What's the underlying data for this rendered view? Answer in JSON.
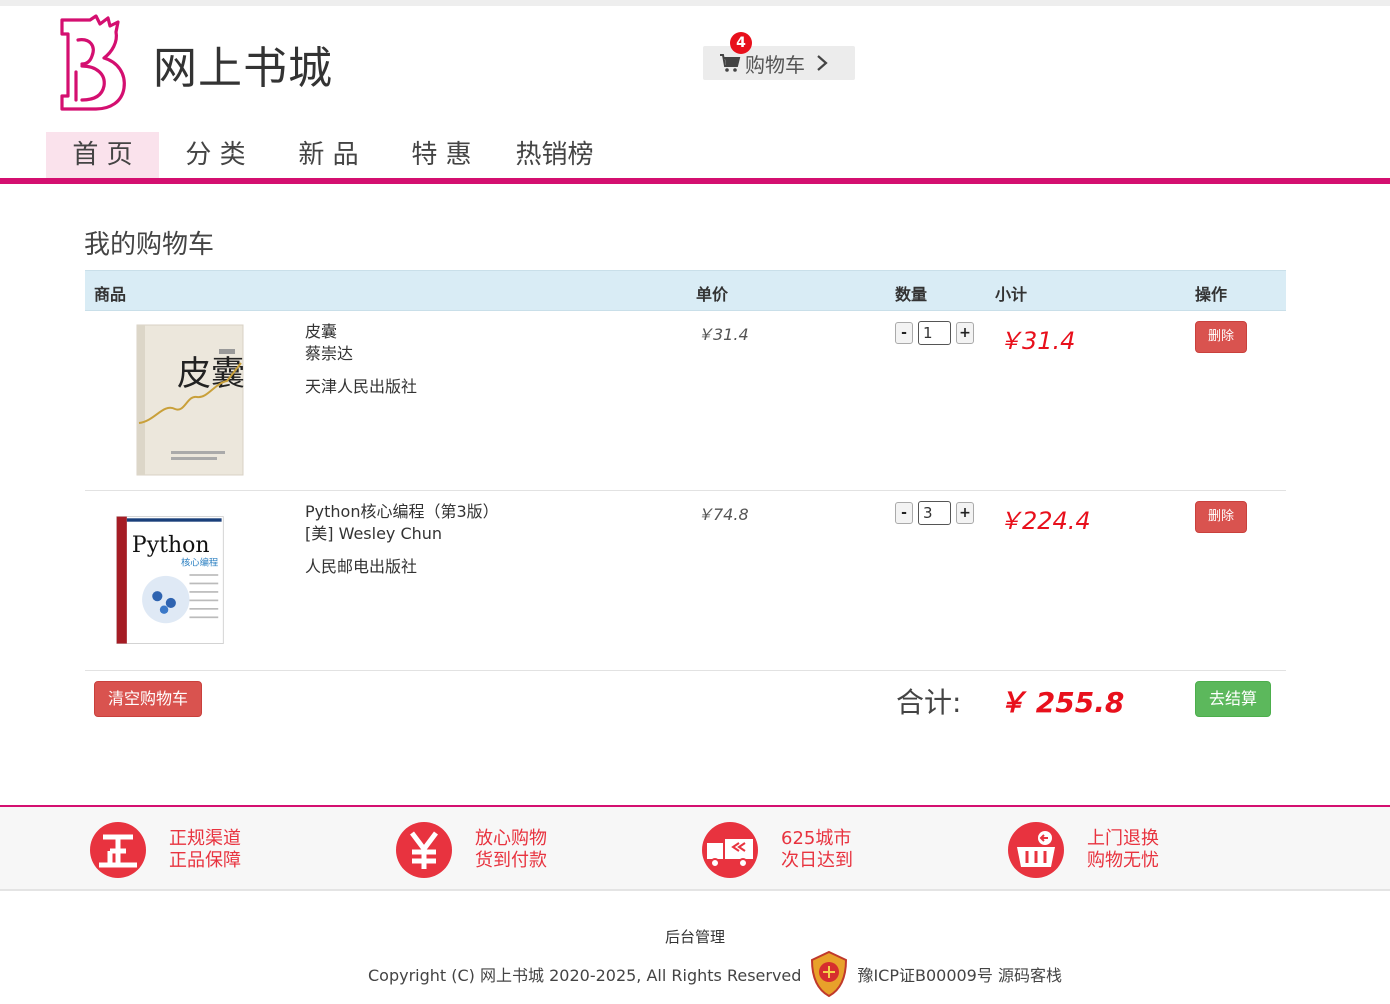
{
  "header": {
    "site_title": "网上书城",
    "cart_label": "购物车",
    "cart_count": "4"
  },
  "nav": {
    "items": [
      {
        "label": "首 页",
        "active": true
      },
      {
        "label": "分 类"
      },
      {
        "label": "新 品"
      },
      {
        "label": "特 惠"
      },
      {
        "label": "热销榜"
      }
    ]
  },
  "cart": {
    "title": "我的购物车",
    "columns": {
      "product": "商品",
      "unit_price": "单价",
      "quantity": "数量",
      "subtotal": "小计",
      "action": "操作"
    },
    "items": [
      {
        "title": "皮囊",
        "author": "蔡崇达",
        "publisher": "天津人民出版社",
        "unit_price": "￥31.4",
        "quantity": "1",
        "subtotal": "￥31.4",
        "delete_label": "删除",
        "cover_text": "皮囊"
      },
      {
        "title": "Python核心编程（第3版）",
        "author": "[美] Wesley Chun",
        "publisher": "人民邮电出版社",
        "unit_price": "￥74.8",
        "quantity": "3",
        "subtotal": "￥224.4",
        "delete_label": "删除",
        "cover_text": "Python"
      }
    ],
    "clear_label": "清空购物车",
    "total_label": "合计:",
    "total_value": "￥ 255.8",
    "checkout_label": "去结算",
    "qty_minus": "-",
    "qty_plus": "+"
  },
  "services": [
    {
      "icon": "genuine-icon",
      "line1": "正规渠道",
      "line2": "正品保障"
    },
    {
      "icon": "yuan-icon",
      "line1": "放心购物",
      "line2": "货到付款"
    },
    {
      "icon": "delivery-truck-icon",
      "line1": "625城市",
      "line2": "次日达到"
    },
    {
      "icon": "return-basket-icon",
      "line1": "上门退换",
      "line2": "购物无忧"
    }
  ],
  "footer": {
    "admin_link": "后台管理",
    "copyright": "Copyright (C) 网上书城 2020-2025, All Rights Reserved",
    "icp": "豫ICP证B00009号 源码客栈"
  },
  "colors": {
    "brand": "#d40f70",
    "price_red": "#e8101c",
    "danger": "#d9534f",
    "success": "#5cb85c",
    "table_header": "#d9ecf5",
    "service_red": "#e8333f"
  }
}
